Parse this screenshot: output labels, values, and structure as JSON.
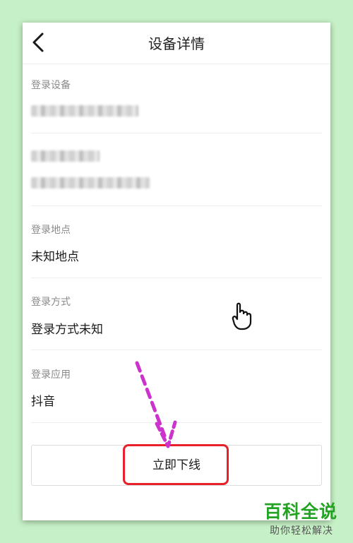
{
  "header": {
    "title": "设备详情",
    "back_icon": "chevron-left-icon"
  },
  "sections": [
    {
      "label": "登录设备"
    },
    {
      "label": "登录地点",
      "value": "未知地点"
    },
    {
      "label": "登录方式",
      "value": "登录方式未知"
    },
    {
      "label": "登录应用",
      "value": "抖音"
    }
  ],
  "action": {
    "offline_label": "立即下线"
  },
  "annotation": {
    "arrow_color": "#cc33cc",
    "highlight_color": "#e8202a"
  },
  "watermark": {
    "line1": "百科全说",
    "line2": "助你轻松解决",
    "color": "#22a322"
  }
}
